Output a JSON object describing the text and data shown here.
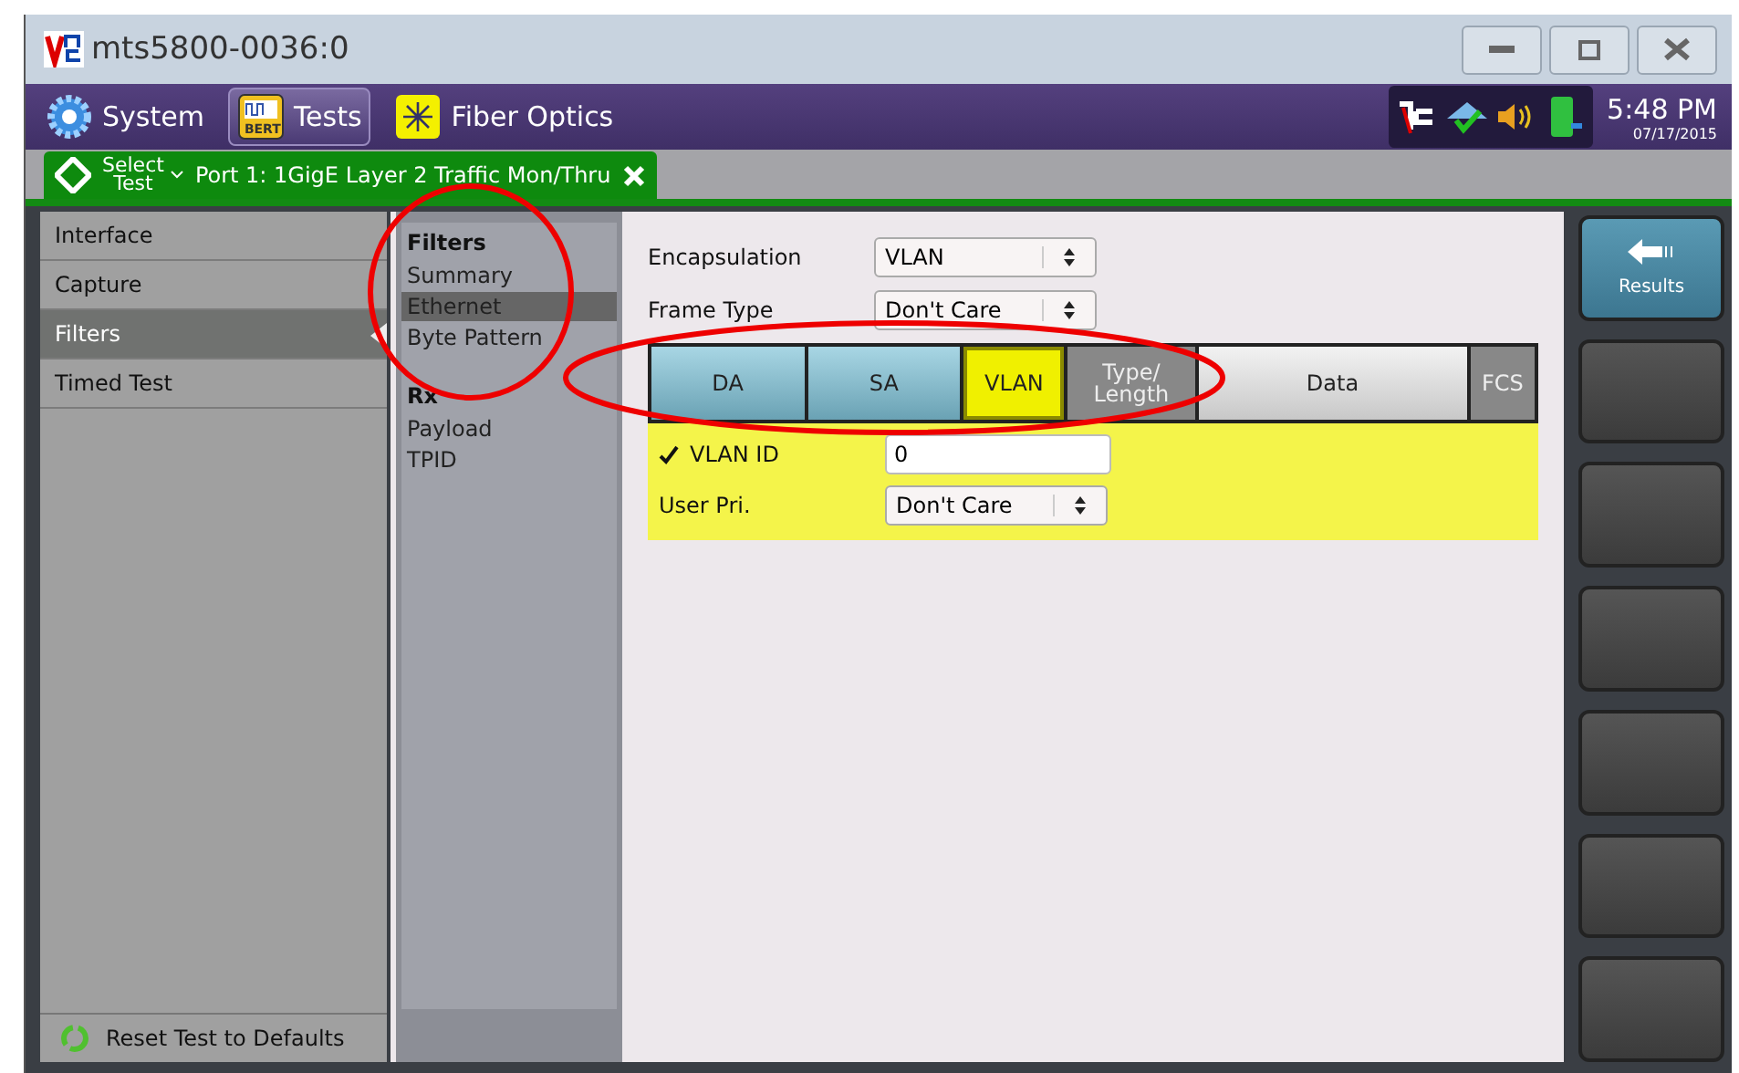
{
  "window": {
    "title": "mts5800-0036:0"
  },
  "toolbar": {
    "items": [
      {
        "label": "System",
        "kind": "gear",
        "selected": false
      },
      {
        "label": "Tests",
        "kind": "bert",
        "selected": true
      },
      {
        "label": "Fiber Optics",
        "kind": "fiber",
        "selected": false
      }
    ],
    "bert_label": "BERT",
    "time": "5:48 PM",
    "date": "07/17/2015"
  },
  "test_tab": {
    "select_label": "Select",
    "select_sub": "Test",
    "title": "Port 1: 1GigE Layer 2 Traffic Mon/Thru"
  },
  "nav": {
    "items": [
      {
        "label": "Interface",
        "selected": false
      },
      {
        "label": "Capture",
        "selected": false
      },
      {
        "label": "Filters",
        "selected": true
      },
      {
        "label": "Timed Test",
        "selected": false
      }
    ],
    "reset": "Reset Test to Defaults"
  },
  "submenu": {
    "groups": [
      {
        "title": "Filters",
        "items": [
          {
            "label": "Summary",
            "selected": false
          },
          {
            "label": "Ethernet",
            "selected": true
          },
          {
            "label": "Byte Pattern",
            "selected": false
          }
        ]
      },
      {
        "title": "Rx",
        "items": [
          {
            "label": "Payload",
            "selected": false
          },
          {
            "label": "TPID",
            "selected": false
          }
        ]
      }
    ]
  },
  "form": {
    "encapsulation": {
      "label": "Encapsulation",
      "value": "VLAN"
    },
    "frame_type": {
      "label": "Frame Type",
      "value": "Don't Care"
    }
  },
  "frame": [
    {
      "label": "DA",
      "kind": "address",
      "selected": false
    },
    {
      "label": "SA",
      "kind": "address",
      "selected": false
    },
    {
      "label": "VLAN",
      "kind": "tag",
      "selected": true
    },
    {
      "label": "Type/\nLength",
      "kind": "type",
      "selected": false
    },
    {
      "label": "Data",
      "kind": "data",
      "selected": false
    },
    {
      "label": "FCS",
      "kind": "trailer",
      "selected": false
    }
  ],
  "vlan": {
    "id_label": "VLAN ID",
    "id_checked": true,
    "id_value": "0",
    "pri_label": "User Pri.",
    "pri_value": "Don't Care"
  },
  "side_buttons": [
    {
      "label": "Results",
      "kind": "back"
    },
    {
      "kind": "blank"
    },
    {
      "kind": "blank"
    },
    {
      "kind": "blank"
    },
    {
      "kind": "blank"
    },
    {
      "kind": "blank"
    },
    {
      "kind": "blank"
    }
  ]
}
